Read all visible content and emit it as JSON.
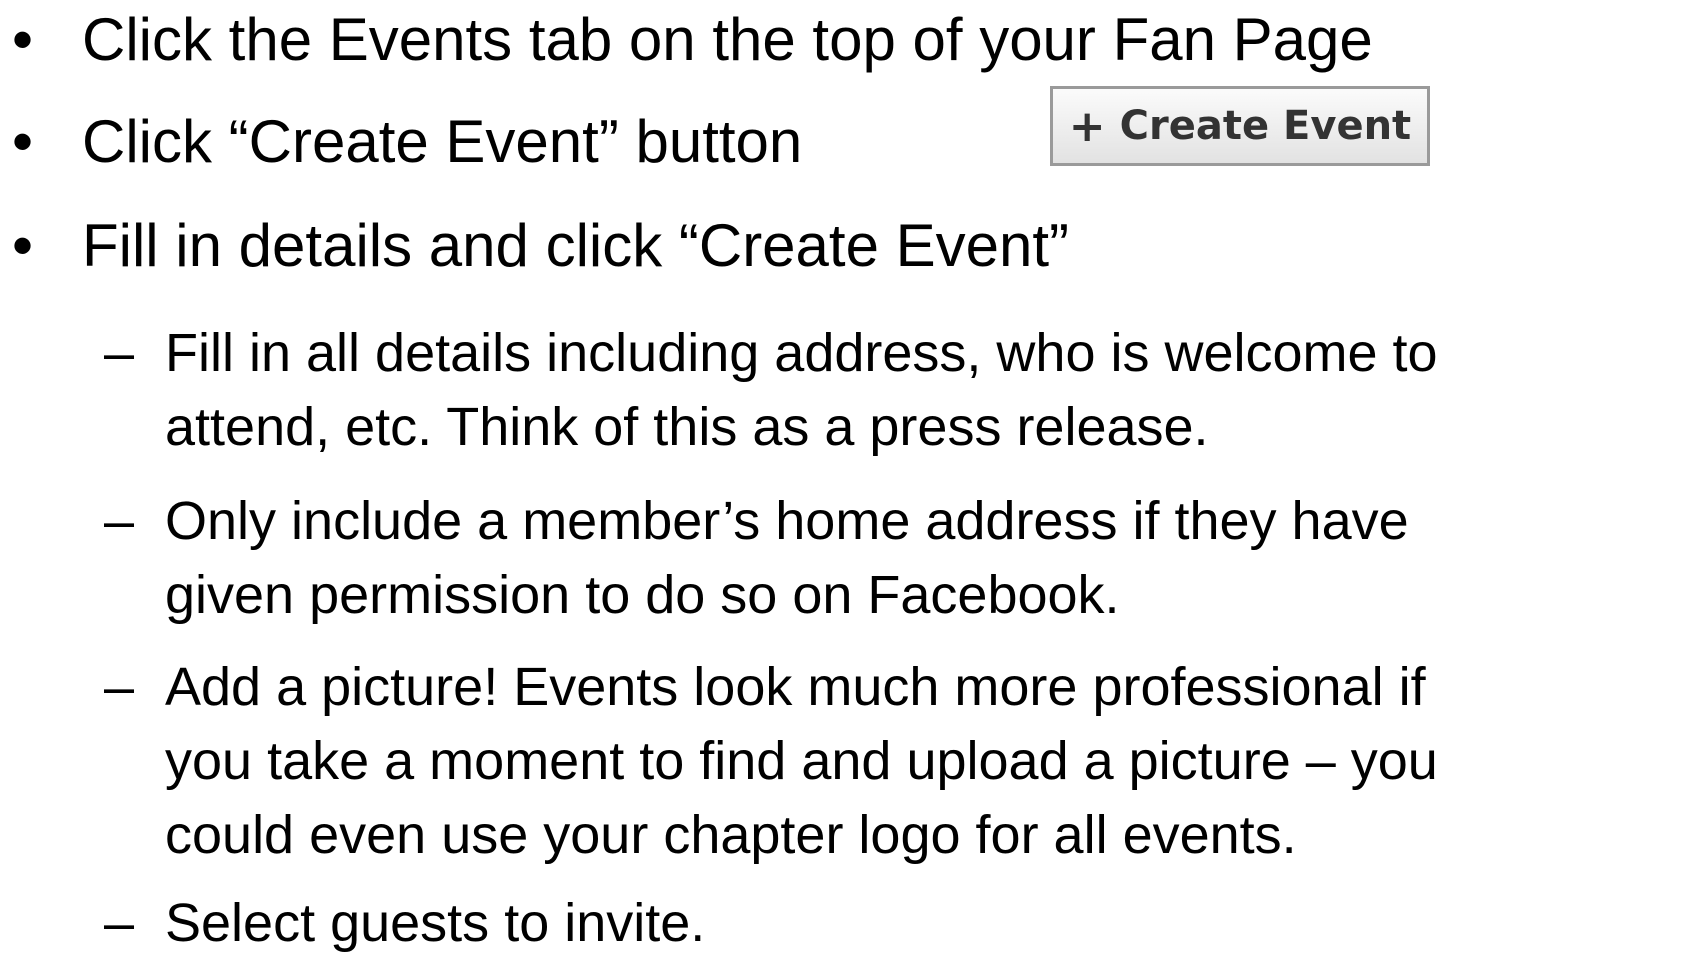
{
  "bullets": [
    {
      "marker": "•",
      "text": "Click the Events tab on the top of your Fan Page"
    },
    {
      "marker": "•",
      "text": "Click “Create Event” button"
    },
    {
      "marker": "•",
      "text": "Fill in details and click “Create Event”"
    }
  ],
  "create_button": {
    "icon": "+",
    "label": "Create Event"
  },
  "sub_bullets": [
    {
      "marker": "–",
      "lines": [
        "Fill in all details including address, who is welcome to",
        "attend, etc.  Think of this as a press release."
      ]
    },
    {
      "marker": "–",
      "lines": [
        "Only include a member’s home address if they have",
        "given permission to do so on Facebook."
      ]
    },
    {
      "marker": "–",
      "lines": [
        "Add a picture!  Events look much more professional if",
        "you take a moment to find and upload a picture – you",
        "could even use your chapter logo for all events."
      ]
    },
    {
      "marker": "–",
      "lines": [
        "Select guests to invite."
      ]
    }
  ]
}
